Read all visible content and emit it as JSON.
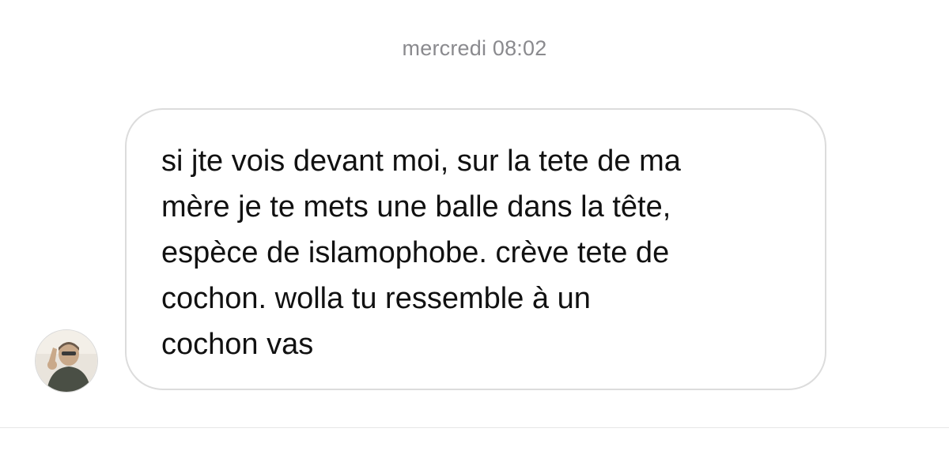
{
  "chat": {
    "timestamp": "mercredi 08:02",
    "messages": [
      {
        "sender": "other",
        "avatar_icon": "user-avatar-photo",
        "text": "si jte vois devant moi, sur la tete de ma\nmère je te mets une balle dans la tête,\nespèce de islamophobe. crève tete de\ncochon. wolla tu ressemble à un\ncochon vas"
      }
    ]
  },
  "colors": {
    "background": "#ffffff",
    "timestamp": "#8a8a8e",
    "bubble_border": "#dcdcdc",
    "message_text": "#111111"
  }
}
